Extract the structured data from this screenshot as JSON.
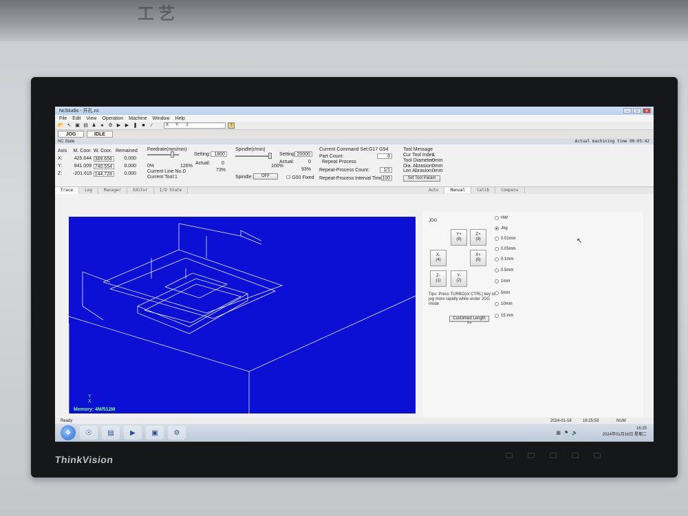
{
  "environment": {
    "cabinet_text": "工艺",
    "monitor_brand": "ThinkVision"
  },
  "window": {
    "title": "NcStudio - 开孔.nc",
    "buttons": [
      "–",
      "□",
      "✕"
    ]
  },
  "menu": [
    "File",
    "Edit",
    "View",
    "Operation",
    "Machine",
    "Window",
    "Help"
  ],
  "toolbar": {
    "coord_x": "X",
    "coord_y": "Y:",
    "coord_z": "2",
    "help": "?"
  },
  "modes": {
    "mode1": "JOG",
    "mode2": "IDLE"
  },
  "state_bar": {
    "label": "NC State",
    "time_label": "Actual machining time",
    "time": "00:05:42"
  },
  "axis_table": {
    "headers": [
      "Axis",
      "M. Coor.",
      "W. Coor.",
      "Remained"
    ],
    "rows": [
      {
        "axis": "X:",
        "m": "425.644",
        "w": "369.656",
        "r": "0.000"
      },
      {
        "axis": "Y:",
        "m": "941.009",
        "w": "740.554",
        "r": "0.000"
      },
      {
        "axis": "Z:",
        "m": "-201.615",
        "w": "144.728",
        "r": "0.000"
      }
    ]
  },
  "feedrate": {
    "label": "Feedrate(mm/min)",
    "setting_label": "Setting:",
    "setting": "1800",
    "actual_label": "Actual:",
    "actual": "0",
    "pct_min": "0%",
    "pct_set": "126%",
    "pct_actual": "73%",
    "cur_line_label": "Current Line No.:",
    "cur_line": "0",
    "cur_tool_label": "Current Tool:",
    "cur_tool": "1"
  },
  "spindle": {
    "label": "Spindle(r/min)",
    "setting_label": "Setting:",
    "setting": "20000",
    "actual_label": "Actual:",
    "actual": "0",
    "pct_actual": "93%",
    "pct_mid": "100%",
    "toggle_label": "Spindle:",
    "toggle": "OFF",
    "g00_label": "G00 Fixed"
  },
  "command": {
    "set_label": "Current Command Set:",
    "set": "G17 G54",
    "part_count_label": "Part Count:",
    "part_count": "6",
    "repeat_label": "Repeat Process",
    "repeat_count_label": "Repeat-Process Count:",
    "repeat_count": "1/1",
    "interval_label": "Repeat-Process Interval Time:",
    "interval": "100"
  },
  "tool_msg": {
    "label": "Tool Message",
    "index_label": "Cur Tool Index:",
    "index": "1",
    "diam_label": "Tool Diameter:",
    "diam": "0mm",
    "dia_abr_label": "Dia. Abrasion:",
    "dia_abr": "0mm",
    "len_abr_label": "Len Abrasion:",
    "len_abr": "0mm",
    "set_btn": "Set Tool Param"
  },
  "left_tabs": [
    "Trace",
    "Log",
    "Manager",
    "Editor",
    "I/O State"
  ],
  "right_tabs": [
    "Auto",
    "Manual",
    "Calib",
    "Compens"
  ],
  "view": {
    "memory": "Memory: 4M/512M",
    "axis_y": "Y",
    "axis_x": "X"
  },
  "manual": {
    "title": "JOG",
    "buttons": {
      "yplus": "Y+\n(8)",
      "zplus": "Z+\n(9)",
      "xminus": "X-\n(4)",
      "xplus": "X+\n(6)",
      "zminus": "Z-\n(1)",
      "yminus": "Y-\n(2)"
    },
    "radios": [
      "HW",
      "Jog",
      "0.01mm",
      "0.05mm",
      "0.1mm",
      "0.5mm",
      "1mm",
      "5mm",
      "10mm",
      "15 mm"
    ],
    "selected": 1,
    "tips": "Tips: Press TURBO(or CTRL) key to jog more rapidly while under JOG mode",
    "custom_btn": "Customed Length >>"
  },
  "status": {
    "text": "Ready",
    "date": "2024-01-16",
    "time": "16:25:53",
    "num": "NUM"
  },
  "taskbar": {
    "clock": "16:25",
    "date": "2024年01月16日 星期二"
  }
}
